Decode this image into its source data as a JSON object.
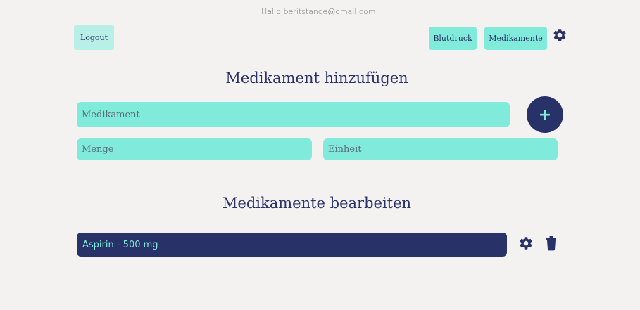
{
  "header": {
    "greeting": "Hallo beritstange@gmail.com!",
    "logout_label": "Logout",
    "nav": [
      {
        "label": "Blutdruck"
      },
      {
        "label": "Medikamente"
      }
    ],
    "settings_icon": "gear-icon"
  },
  "add_section": {
    "title": "Medikament hinzufügen",
    "medikament_placeholder": "Medikament",
    "menge_placeholder": "Menge",
    "einheit_placeholder": "Einheit",
    "add_button_label": "+"
  },
  "edit_section": {
    "title": "Medikamente bearbeiten",
    "items": [
      {
        "label": "Aspirin - 500 mg",
        "edit_icon": "gear-icon",
        "delete_icon": "trash-icon"
      }
    ]
  },
  "colors": {
    "background": "#f4f2f1",
    "accent_mint": "#80ebda",
    "accent_light": "#b8efe6",
    "navy": "#283168"
  }
}
